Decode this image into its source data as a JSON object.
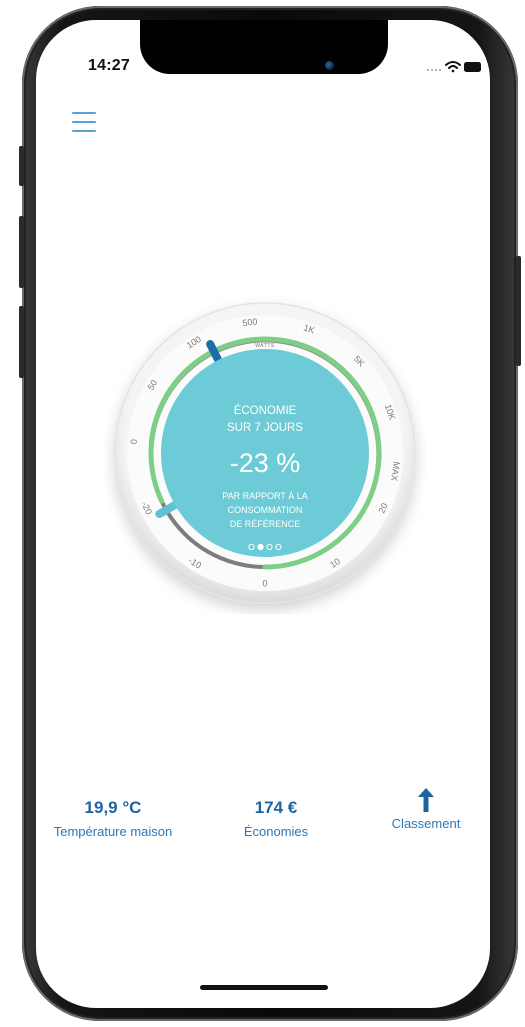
{
  "status": {
    "time": "14:27"
  },
  "gauge": {
    "title_line1": "ÉCONOMIE",
    "title_line2": "SUR 7 JOURS",
    "value": "-23 %",
    "subtitle_line1": "PAR RAPPORT À LA",
    "subtitle_line2": "CONSOMMATION",
    "subtitle_line3": "DE RÉFÉRENCE",
    "unit_label": "WATTS",
    "outer_ticks": [
      "0",
      "50",
      "100",
      "500",
      "1K",
      "5K",
      "10K",
      "MAX"
    ],
    "inner_ticks": [
      "-20",
      "-10",
      "0",
      "10",
      "20"
    ],
    "page_dots": 4,
    "active_dot": 1,
    "colors": {
      "center": "#6ccbd6",
      "outer_marker": "#1f6da8",
      "inner_green": "#7ccf85",
      "inner_marker": "#5cc3d5"
    }
  },
  "stats": {
    "temperature_value": "19,9 °C",
    "temperature_label": "Température maison",
    "savings_value": "174 €",
    "savings_label": "Économies",
    "ranking_label": "Classement",
    "ranking_icon": "arrow-up-icon"
  }
}
